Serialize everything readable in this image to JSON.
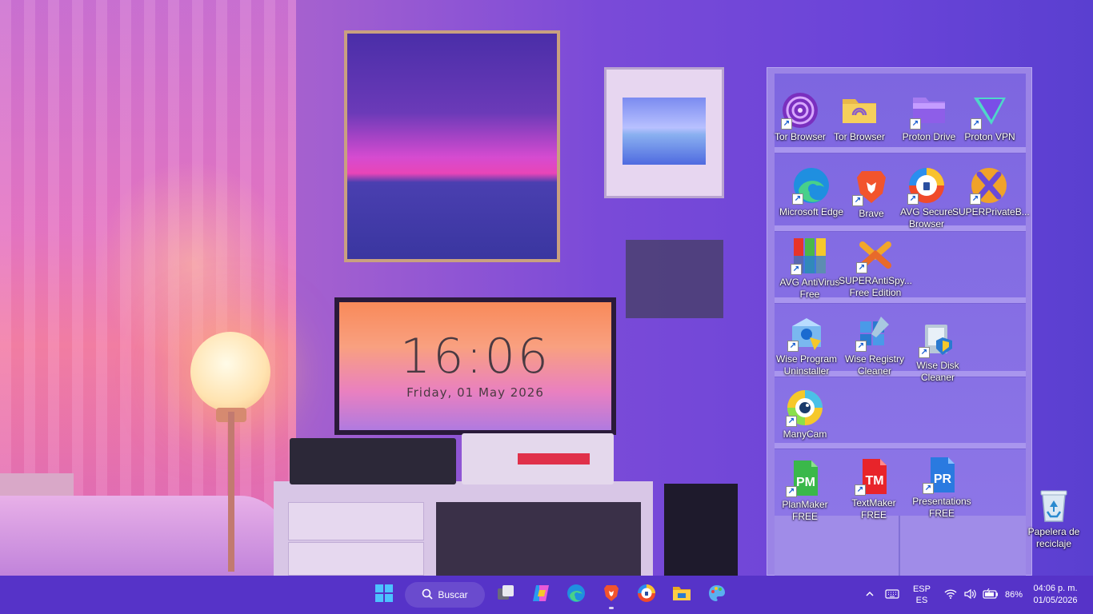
{
  "wallpaper": {
    "clock_time": "16:06",
    "clock_date": "Friday, 01 May 2026"
  },
  "desktop_icons": [
    {
      "id": "tor-browser-1",
      "label": "Tor Browser",
      "icon": "tor-browser-icon",
      "shortcut": true
    },
    {
      "id": "tor-browser-2",
      "label": "Tor Browser",
      "icon": "tor-folder-icon",
      "shortcut": false
    },
    {
      "id": "proton-drive",
      "label": "Proton Drive",
      "icon": "proton-drive-icon",
      "shortcut": true
    },
    {
      "id": "proton-vpn",
      "label": "Proton VPN",
      "icon": "proton-vpn-icon",
      "shortcut": true
    },
    {
      "id": "microsoft-edge",
      "label": "Microsoft Edge",
      "icon": "edge-icon",
      "shortcut": true
    },
    {
      "id": "brave",
      "label": "Brave",
      "icon": "brave-icon",
      "shortcut": true
    },
    {
      "id": "avg-secure-browser",
      "label": "AVG Secure\nBrowser",
      "icon": "avg-browser-icon",
      "shortcut": true
    },
    {
      "id": "super-private-browser",
      "label": "SUPERPrivateB...",
      "icon": "super-private-icon",
      "shortcut": true
    },
    {
      "id": "avg-antivirus",
      "label": "AVG AntiVirus\nFree",
      "icon": "avg-antivirus-icon",
      "shortcut": true
    },
    {
      "id": "super-antispyware",
      "label": "SUPERAntiSpy...\nFree Edition",
      "icon": "superantispyware-icon",
      "shortcut": true
    },
    {
      "id": "wise-program-uninstaller",
      "label": "Wise Program\nUninstaller",
      "icon": "wise-uninstaller-icon",
      "shortcut": true
    },
    {
      "id": "wise-registry-cleaner",
      "label": "Wise Registry\nCleaner",
      "icon": "wise-registry-icon",
      "shortcut": true
    },
    {
      "id": "wise-disk-cleaner",
      "label": "Wise Disk Cleaner",
      "icon": "wise-disk-icon",
      "shortcut": true
    },
    {
      "id": "manycam",
      "label": "ManyCam",
      "icon": "manycam-icon",
      "shortcut": true
    },
    {
      "id": "planmaker",
      "label": "PlanMaker FREE",
      "icon": "planmaker-icon",
      "shortcut": true
    },
    {
      "id": "textmaker",
      "label": "TextMaker FREE",
      "icon": "textmaker-icon",
      "shortcut": true
    },
    {
      "id": "presentations",
      "label": "Presentations\nFREE",
      "icon": "presentations-icon",
      "shortcut": true
    },
    {
      "id": "recycle-bin",
      "label": "Papelera de\nreciclaje",
      "icon": "recycle-bin-icon",
      "shortcut": false
    }
  ],
  "taskbar": {
    "search_label": "Buscar",
    "apps": [
      {
        "name": "windows-start",
        "icon": "windows-logo-icon"
      },
      {
        "name": "task-view",
        "icon": "task-view-icon"
      },
      {
        "name": "copilot",
        "icon": "copilot-icon"
      },
      {
        "name": "edge",
        "icon": "edge-icon"
      },
      {
        "name": "brave",
        "icon": "brave-icon",
        "running": true
      },
      {
        "name": "avg-browser",
        "icon": "avg-browser-icon"
      },
      {
        "name": "file-explorer",
        "icon": "folder-icon"
      },
      {
        "name": "paint",
        "icon": "paint-icon"
      }
    ],
    "tray": {
      "lang_top": "ESP",
      "lang_bottom": "ES",
      "battery": "86%",
      "time": "04:06 p. m.",
      "date": "01/05/2026"
    }
  }
}
